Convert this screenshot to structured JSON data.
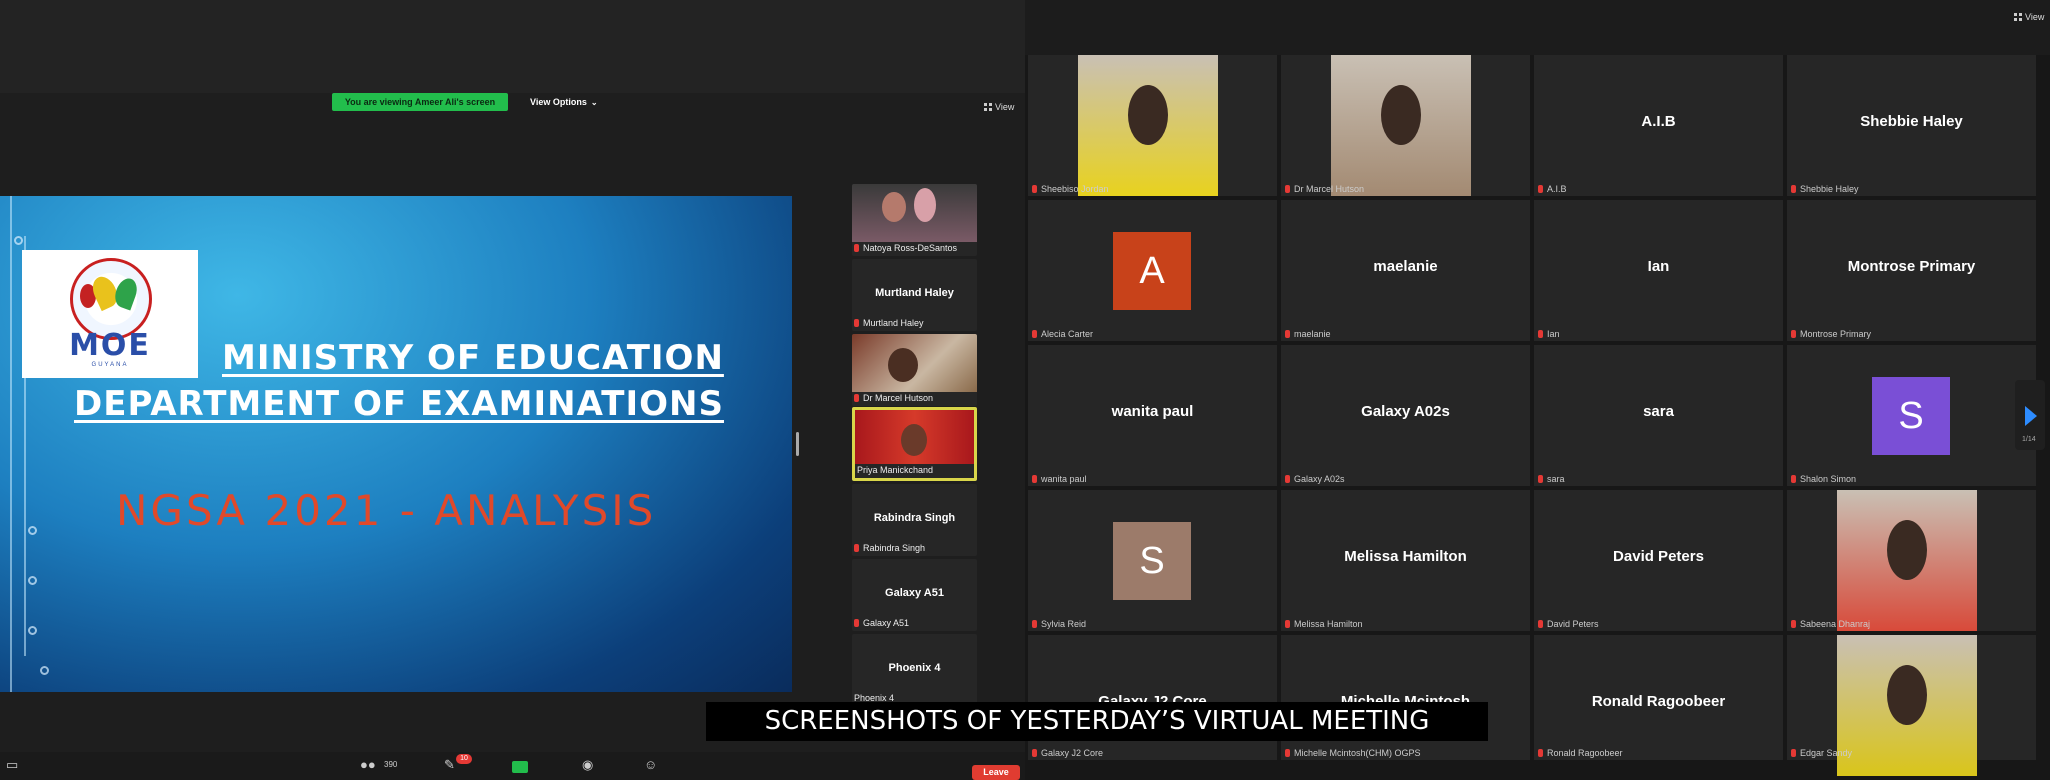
{
  "left_panel": {
    "banner_text": "You are viewing Ameer Ali's screen",
    "view_options_label": "View Options",
    "view_label": "View",
    "slide": {
      "logo_text": "MOE",
      "logo_subtext": "GUYANA",
      "title_line1": "MINISTRY OF EDUCATION",
      "title_line2": "DEPARTMENT OF EXAMINATIONS",
      "subtitle": "NGSA 2021 - ANALYSIS"
    },
    "filmstrip": [
      {
        "label": "Natoya Ross-DeSantos",
        "type": "video"
      },
      {
        "name": "Murtland Haley",
        "label": "Murtland Haley",
        "type": "name"
      },
      {
        "label": "Dr Marcel Hutson",
        "type": "video"
      },
      {
        "label": "Priya Manickchand",
        "type": "video",
        "active": true
      },
      {
        "name": "Rabindra Singh",
        "label": "Rabindra Singh",
        "type": "name"
      },
      {
        "name": "Galaxy A51",
        "label": "Galaxy A51",
        "type": "name"
      },
      {
        "name": "Phoenix 4",
        "label": "Phoenix 4",
        "type": "name"
      }
    ],
    "toolbar": {
      "participants_count": "390",
      "chat_badge": "10",
      "leave_label": "Leave"
    }
  },
  "right_panel": {
    "view_label": "View",
    "page_indicator": "1/14",
    "tiles": [
      {
        "label": "Sheebiso Jordan",
        "type": "video",
        "color": "#e8d21e"
      },
      {
        "label": "Dr Marcel Hutson",
        "type": "video",
        "color": "#a38a72"
      },
      {
        "name": "A.I.B",
        "label": "A.I.B",
        "type": "name"
      },
      {
        "name": "Shebbie Haley",
        "label": "Shebbie Haley",
        "type": "name"
      },
      {
        "avatar": "A",
        "label": "Alecia Carter",
        "type": "avatar",
        "color": "#c8421a"
      },
      {
        "name": "maelanie",
        "label": "maelanie",
        "type": "name"
      },
      {
        "name": "Ian",
        "label": "Ian",
        "type": "name"
      },
      {
        "name": "Montrose Primary",
        "label": "Montrose Primary",
        "type": "name"
      },
      {
        "name": "wanita paul",
        "label": "wanita paul",
        "type": "name"
      },
      {
        "name": "Galaxy A02s",
        "label": "Galaxy A02s",
        "type": "name"
      },
      {
        "name": "sara",
        "label": "sara",
        "type": "name"
      },
      {
        "avatar": "S",
        "label": "Shalon Simon",
        "type": "avatar",
        "color": "#7a4fd6"
      },
      {
        "avatar": "S",
        "label": "Sylvia Reid",
        "type": "avatar",
        "color": "#9c7b6a"
      },
      {
        "name": "Melissa Hamilton",
        "label": "Melissa Hamilton",
        "type": "name"
      },
      {
        "name": "David Peters",
        "label": "David Peters",
        "type": "name"
      },
      {
        "label": "Sabeena Dhanraj",
        "type": "video",
        "color": "#d84a3a"
      },
      {
        "name": "Galaxy J2 Core",
        "label": "Galaxy J2 Core",
        "type": "name"
      },
      {
        "name": "Michelle Mcintosh",
        "label": "Michelle Mcintosh(CHM) OGPS",
        "type": "name"
      },
      {
        "name": "Ronald Ragoobeer",
        "label": "Ronald Ragoobeer",
        "type": "name"
      },
      {
        "label": "Edgar Sandy",
        "type": "video",
        "color": "#d9c51a"
      }
    ]
  },
  "caption": "SCREENSHOTS OF YESTERDAY’S VIRTUAL MEETING"
}
